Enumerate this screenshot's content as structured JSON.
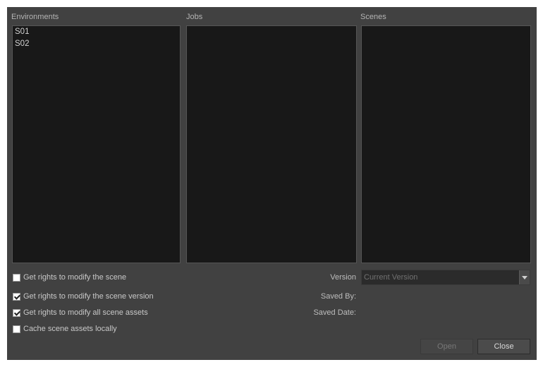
{
  "panes": {
    "environments": {
      "label": "Environments",
      "items": [
        "S01",
        "S02"
      ]
    },
    "jobs": {
      "label": "Jobs",
      "items": []
    },
    "scenes": {
      "label": "Scenes",
      "items": []
    }
  },
  "options": [
    {
      "label": "Get rights to modify the scene",
      "checked": false
    },
    {
      "label": "Get rights to modify the scene version",
      "checked": true
    },
    {
      "label": "Get rights to modify all scene assets",
      "checked": true
    },
    {
      "label": "Cache scene assets locally",
      "checked": false
    }
  ],
  "version": {
    "label": "Version",
    "value": "Current Version"
  },
  "saved_by": {
    "label": "Saved By:"
  },
  "saved_date": {
    "label": "Saved Date:"
  },
  "buttons": {
    "open": "Open",
    "close": "Close"
  }
}
